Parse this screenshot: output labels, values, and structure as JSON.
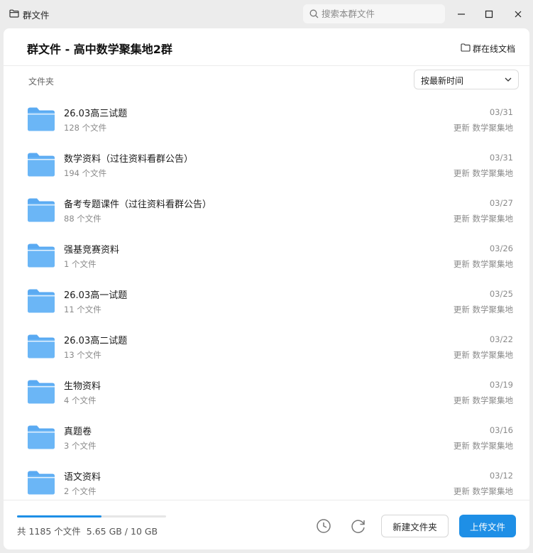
{
  "window": {
    "title": "群文件",
    "search_placeholder": "搜索本群文件"
  },
  "header": {
    "title": "群文件 - 高中数学聚集地2群",
    "online_docs_label": "群在线文档"
  },
  "toolbar": {
    "folder_label": "文件夹",
    "sort_selected": "按最新时间"
  },
  "folders": [
    {
      "name": "26.03高三试题",
      "count": "128 个文件",
      "date": "03/31",
      "updated_by": "更新 数学聚集地"
    },
    {
      "name": "数学资料（过往资料看群公告）",
      "count": "194 个文件",
      "date": "03/31",
      "updated_by": "更新 数学聚集地"
    },
    {
      "name": "备考专题课件（过往资料看群公告）",
      "count": "88 个文件",
      "date": "03/27",
      "updated_by": "更新 数学聚集地"
    },
    {
      "name": "强基竞赛资料",
      "count": "1 个文件",
      "date": "03/26",
      "updated_by": "更新 数学聚集地"
    },
    {
      "name": "26.03高一试题",
      "count": "11 个文件",
      "date": "03/25",
      "updated_by": "更新 数学聚集地"
    },
    {
      "name": "26.03高二试题",
      "count": "13 个文件",
      "date": "03/22",
      "updated_by": "更新 数学聚集地"
    },
    {
      "name": "生物资料",
      "count": "4 个文件",
      "date": "03/19",
      "updated_by": "更新 数学聚集地"
    },
    {
      "name": "真题卷",
      "count": "3 个文件",
      "date": "03/16",
      "updated_by": "更新 数学聚集地"
    },
    {
      "name": "语文资料",
      "count": "2 个文件",
      "date": "03/12",
      "updated_by": "更新 数学聚集地"
    }
  ],
  "footer": {
    "total_files": "共 1185 个文件",
    "storage": "5.65 GB / 10 GB",
    "storage_used_fraction": 0.565,
    "new_folder_label": "新建文件夹",
    "upload_label": "上传文件"
  },
  "colors": {
    "accent": "#1e8fe6",
    "folder": "#5aaaf2"
  }
}
